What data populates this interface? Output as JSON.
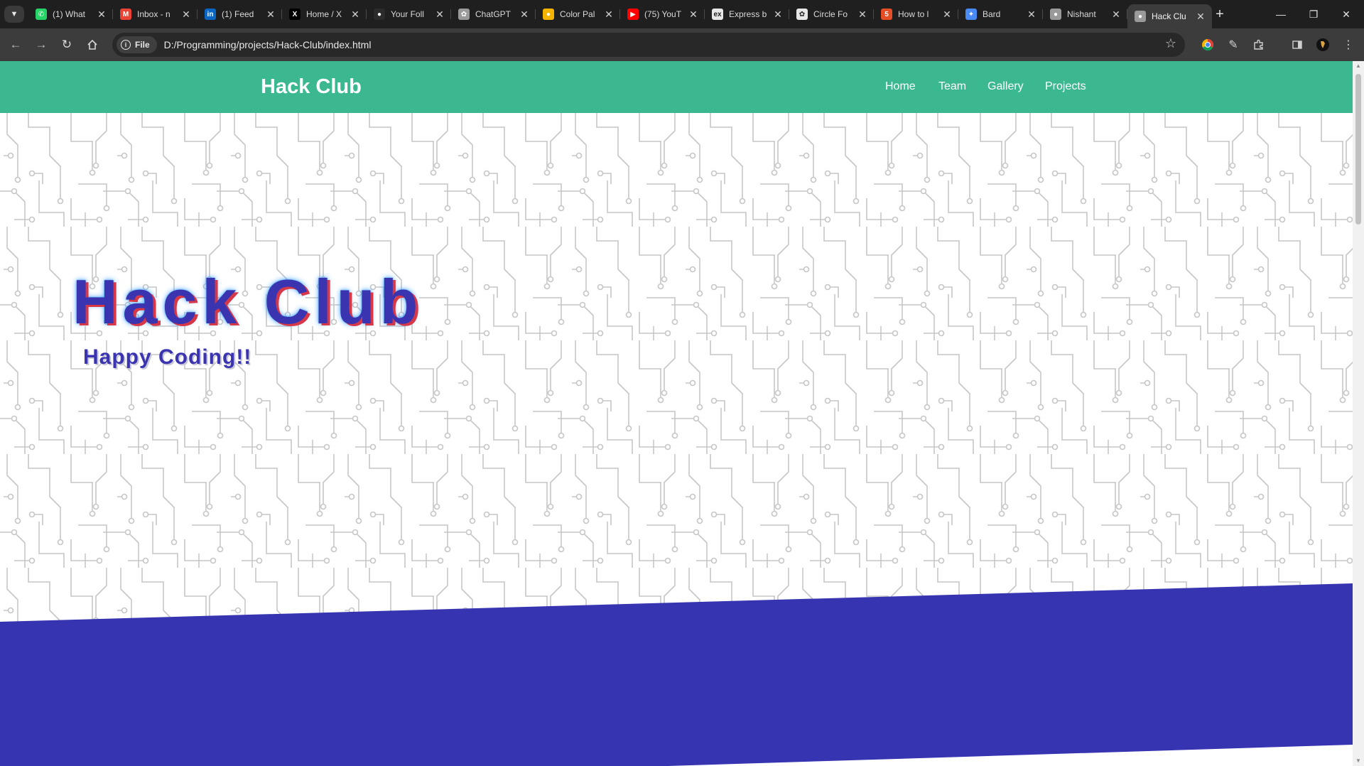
{
  "browser": {
    "tabs": [
      {
        "title": "(1) What",
        "favicon": "whatsapp-icon",
        "color": "#25d366"
      },
      {
        "title": "Inbox - n",
        "favicon": "gmail-icon",
        "color": "#ea4335"
      },
      {
        "title": "(1) Feed",
        "favicon": "linkedin-icon",
        "color": "#0a66c2"
      },
      {
        "title": "Home / X",
        "favicon": "x-icon",
        "color": "#000000"
      },
      {
        "title": "Your Foll",
        "favicon": "github-icon",
        "color": "#2b2b2b"
      },
      {
        "title": "ChatGPT",
        "favicon": "chatgpt-icon",
        "color": "#9a9a9a"
      },
      {
        "title": "Color Pal",
        "favicon": "palette-icon",
        "color": "#f5b400"
      },
      {
        "title": "(75) YouT",
        "favicon": "youtube-icon",
        "color": "#ff0000"
      },
      {
        "title": "Express b",
        "favicon": "express-icon",
        "color": "#e8e8e8"
      },
      {
        "title": "Circle Fo",
        "favicon": "openai-icon",
        "color": "#e8e8e8"
      },
      {
        "title": "How to l",
        "favicon": "html-icon",
        "color": "#e44d26"
      },
      {
        "title": "Bard",
        "favicon": "bard-icon",
        "color": "#4a8af4"
      },
      {
        "title": "Nishant",
        "favicon": "globe-icon",
        "color": "#9a9a9a"
      },
      {
        "title": "Hack Clu",
        "favicon": "globe-icon",
        "color": "#9a9a9a"
      }
    ],
    "chip_label": "File",
    "url": "D:/Programming/projects/Hack-Club/index.html"
  },
  "site": {
    "brand": "Hack Club",
    "nav": [
      "Home",
      "Team",
      "Gallery",
      "Projects"
    ],
    "hero_title": "Hack Club",
    "hero_subtitle": "Happy Coding!!"
  },
  "colors": {
    "nav_bg": "#3cb891",
    "band": "#3634b0",
    "title": "#3a34b0",
    "circuit_line": "#c9c9c9"
  }
}
